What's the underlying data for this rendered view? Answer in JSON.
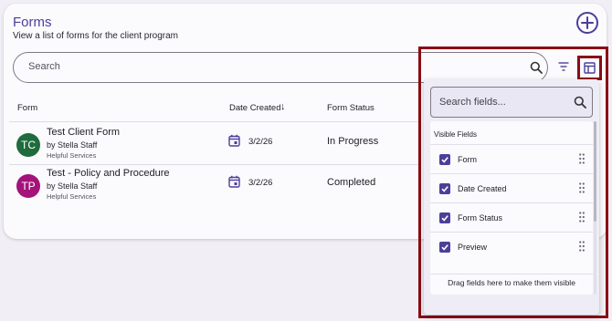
{
  "page": {
    "title": "Forms",
    "subtitle": "View a list of forms for the client program",
    "add_icon": "plus-circle-icon"
  },
  "search": {
    "placeholder": "Search",
    "value": ""
  },
  "toolbar": {
    "filter_icon": "filter-icon",
    "columns_icon": "table-columns-icon"
  },
  "table": {
    "columns": [
      "Form",
      "Date Created",
      "Form Status"
    ],
    "sort": {
      "column": "Date Created",
      "direction": "descending"
    },
    "rows": [
      {
        "initials": "TC",
        "avatar_color": "#1e6b3c",
        "name": "Test Client Form",
        "by": "by Stella Staff",
        "service": "Helpful Services",
        "date": "3/2/26",
        "status": "In Progress"
      },
      {
        "initials": "TP",
        "avatar_color": "#a3137a",
        "name": "Test - Policy and Procedure",
        "by": "by Stella Staff",
        "service": "Helpful Services",
        "date": "3/2/26",
        "status": "Completed"
      }
    ]
  },
  "fields_panel": {
    "search_placeholder": "Search fields...",
    "visible_heading": "Visible Fields",
    "fields": [
      {
        "label": "Form",
        "checked": true
      },
      {
        "label": "Date Created",
        "checked": true
      },
      {
        "label": "Form Status",
        "checked": true
      },
      {
        "label": "Preview",
        "checked": true
      }
    ],
    "drop_hint": "Drag fields here to make them visible"
  },
  "colors": {
    "accent": "#4b3f9a",
    "highlight": "#8b0c14",
    "background": "#f1eff5"
  }
}
